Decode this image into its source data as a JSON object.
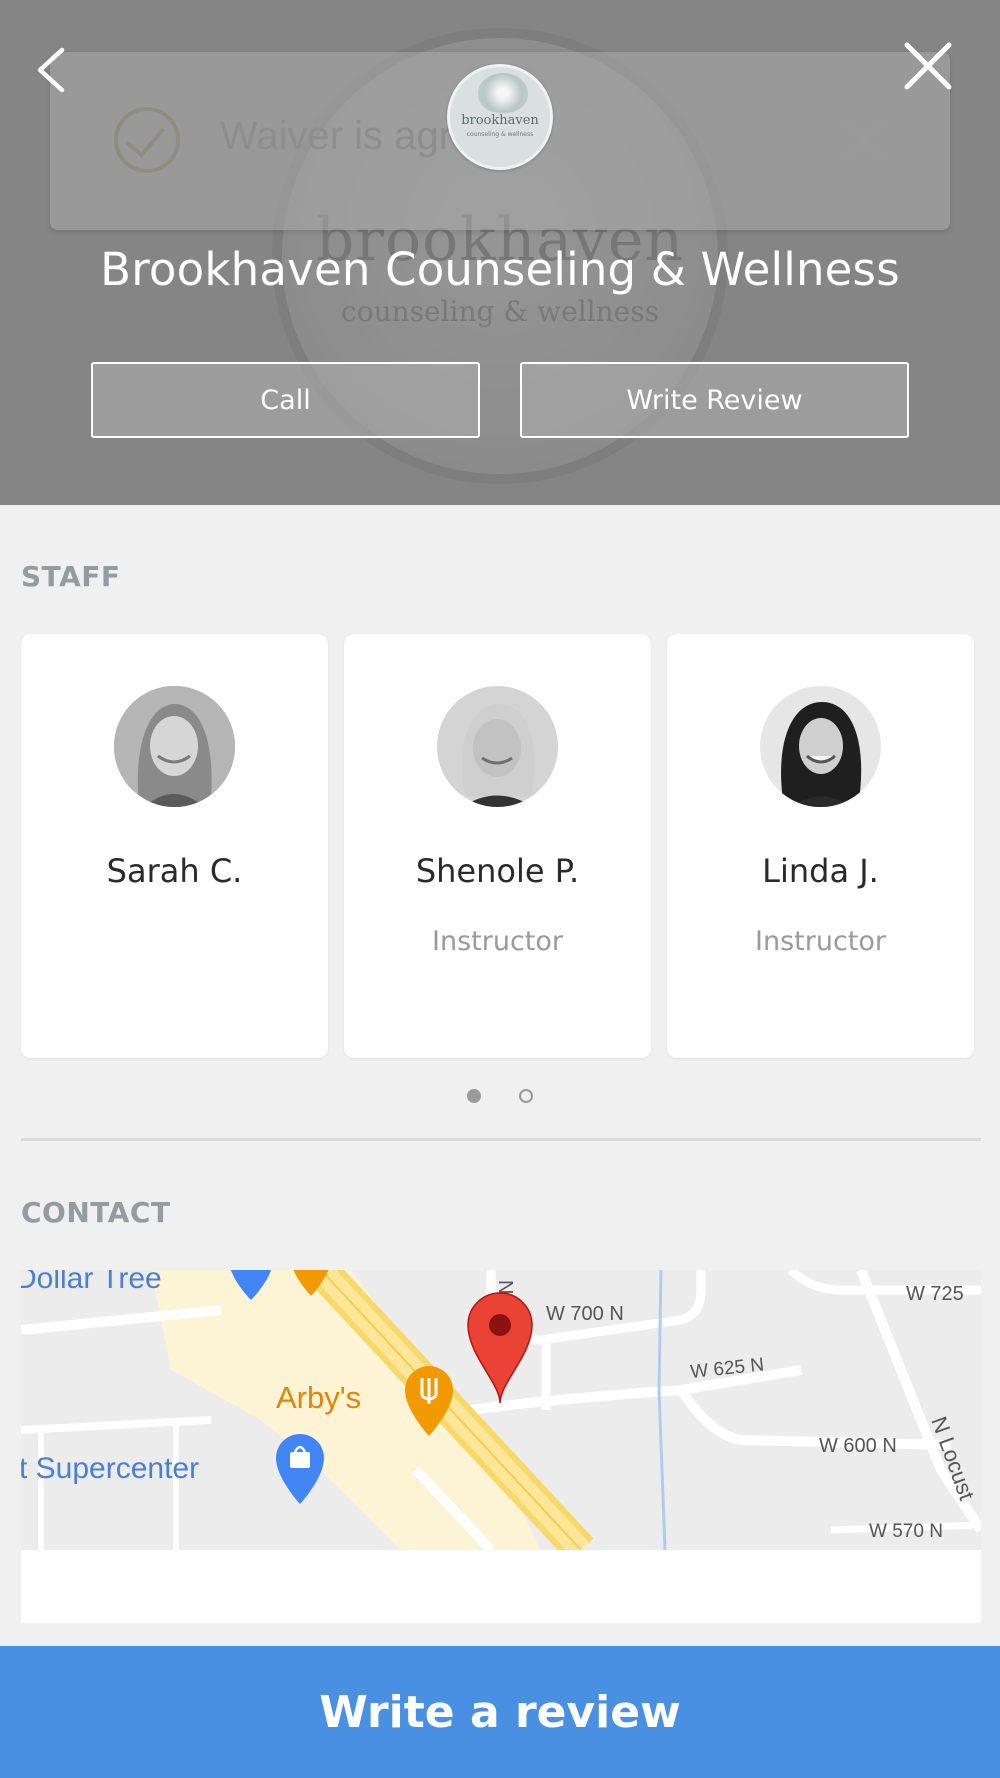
{
  "header": {
    "business_name": "Brookhaven Counseling & Wellness",
    "call_label": "Call",
    "write_review_label": "Write Review",
    "background_brand": "brookhaven",
    "background_brand_sub": "counseling & wellness"
  },
  "logo": {
    "name": "brookhaven",
    "tagline": "counseling & wellness"
  },
  "toast": {
    "message": "Waiver is agreed."
  },
  "icons": {
    "back": "chevron-left-icon",
    "close": "close-icon",
    "toast_check": "check-circle-icon",
    "toast_close": "close-icon",
    "map_pin": "map-pin-icon",
    "restaurant": "restaurant-icon",
    "shopping": "shopping-bag-icon"
  },
  "staff": {
    "title": "STAFF",
    "members": [
      {
        "name": "Sarah C.",
        "role": ""
      },
      {
        "name": "Shenole P.",
        "role": "Instructor"
      },
      {
        "name": "Linda J.",
        "role": "Instructor"
      }
    ],
    "page_count": 2,
    "current_page": 1
  },
  "contact": {
    "title": "CONTACT",
    "map_labels": {
      "dollar_tree": "Dollar Tree",
      "arbys": "Arby's",
      "supercenter": "t Supercenter",
      "w700n": "W 700 N",
      "w725": "W 725",
      "w625n": "W 625 N",
      "w600n": "W 600 N",
      "w570n": "W 570 N",
      "n_locust": "N Locust",
      "n_street": "N"
    }
  },
  "cta": {
    "label": "Write a review"
  },
  "colors": {
    "cta_blue": "#4a90e2",
    "pin_red": "#ea4335",
    "poi_orange": "#f29900",
    "poi_blue": "#4285f4"
  }
}
